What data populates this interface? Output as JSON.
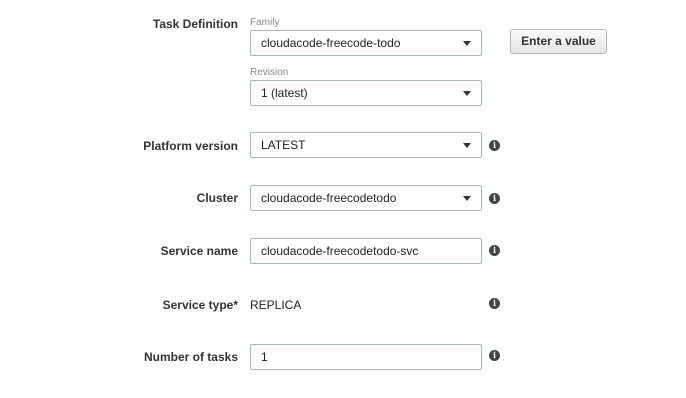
{
  "task_definition": {
    "label": "Task Definition",
    "family_label": "Family",
    "family_value": "cloudacode-freecode-todo",
    "revision_label": "Revision",
    "revision_value": "1 (latest)",
    "enter_value_button": "Enter a value"
  },
  "platform_version": {
    "label": "Platform version",
    "value": "LATEST"
  },
  "cluster": {
    "label": "Cluster",
    "value": "cloudacode-freecodetodo"
  },
  "service_name": {
    "label": "Service name",
    "value": "cloudacode-freecodetodo-svc"
  },
  "service_type": {
    "label": "Service type*",
    "value": "REPLICA"
  },
  "number_of_tasks": {
    "label": "Number of tasks",
    "value": "1"
  },
  "info_glyph": "i"
}
